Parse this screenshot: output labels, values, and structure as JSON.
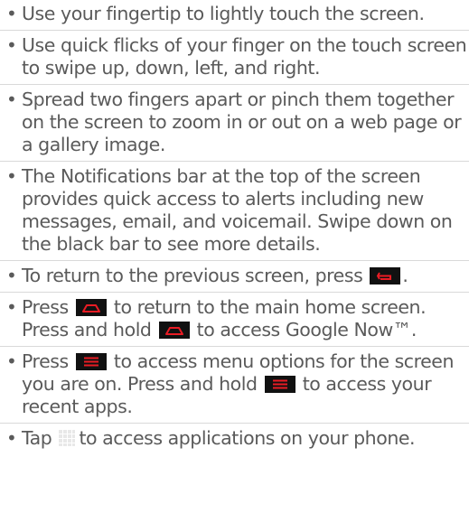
{
  "bullets": [
    {
      "text": "Use your fingertip to lightly touch the screen."
    },
    {
      "text": "Use quick flicks of your finger on the touch screen to swipe up, down, left, and right."
    },
    {
      "text": "Spread two fingers apart or pinch them together on the screen to zoom in or out on a web page or a gallery image."
    },
    {
      "text": "The Notifications bar at the top of the screen provides quick access to alerts including new messages, email, and voicemail. Swipe down on the black bar to see more details."
    },
    {
      "text_before": "To return to the previous screen, press",
      "text_after": ".",
      "icon": "back-key-icon"
    },
    {
      "text_1": "Press",
      "text_2": "to return to the main home screen. Press and hold",
      "text_3": "to access Google Now™.",
      "icon": "home-key-icon"
    },
    {
      "text_1": "Press",
      "text_2": "to access menu options for the screen you are on. Press and hold",
      "text_3": "to access your recent apps.",
      "icon": "menu-key-icon"
    },
    {
      "text_before": "Tap",
      "text_after": "to access applications on your phone.",
      "icon": "apps-grid-icon"
    }
  ],
  "colors": {
    "text": "#5a5a5a",
    "key_background": "#111111",
    "key_accent": "#e91c24",
    "divider": "#d9d9d9"
  }
}
